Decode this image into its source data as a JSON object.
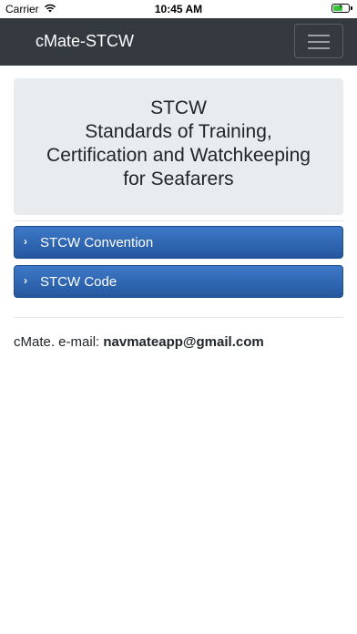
{
  "status_bar": {
    "carrier": "Carrier",
    "wifi_icon": "wifi-icon",
    "time": "10:45 AM",
    "battery_icon": "battery-charging-icon"
  },
  "navbar": {
    "brand": "cMate-STCW",
    "menu_icon": "hamburger-menu-icon",
    "background": "#343a40"
  },
  "header": {
    "line1": "STCW",
    "line2": "Standards of Training,",
    "line3": "Certification and Watchkeeping",
    "line4": "for Seafarers"
  },
  "sections": [
    {
      "label": "STCW Convention",
      "icon": "chevron-right-icon"
    },
    {
      "label": "STCW Code",
      "icon": "chevron-right-icon"
    }
  ],
  "footer": {
    "prefix": "cMate. e-mail: ",
    "email": "navmateapp@gmail.com"
  },
  "colors": {
    "button_blue": "#2f66b3",
    "header_bg": "#e9ecef"
  }
}
